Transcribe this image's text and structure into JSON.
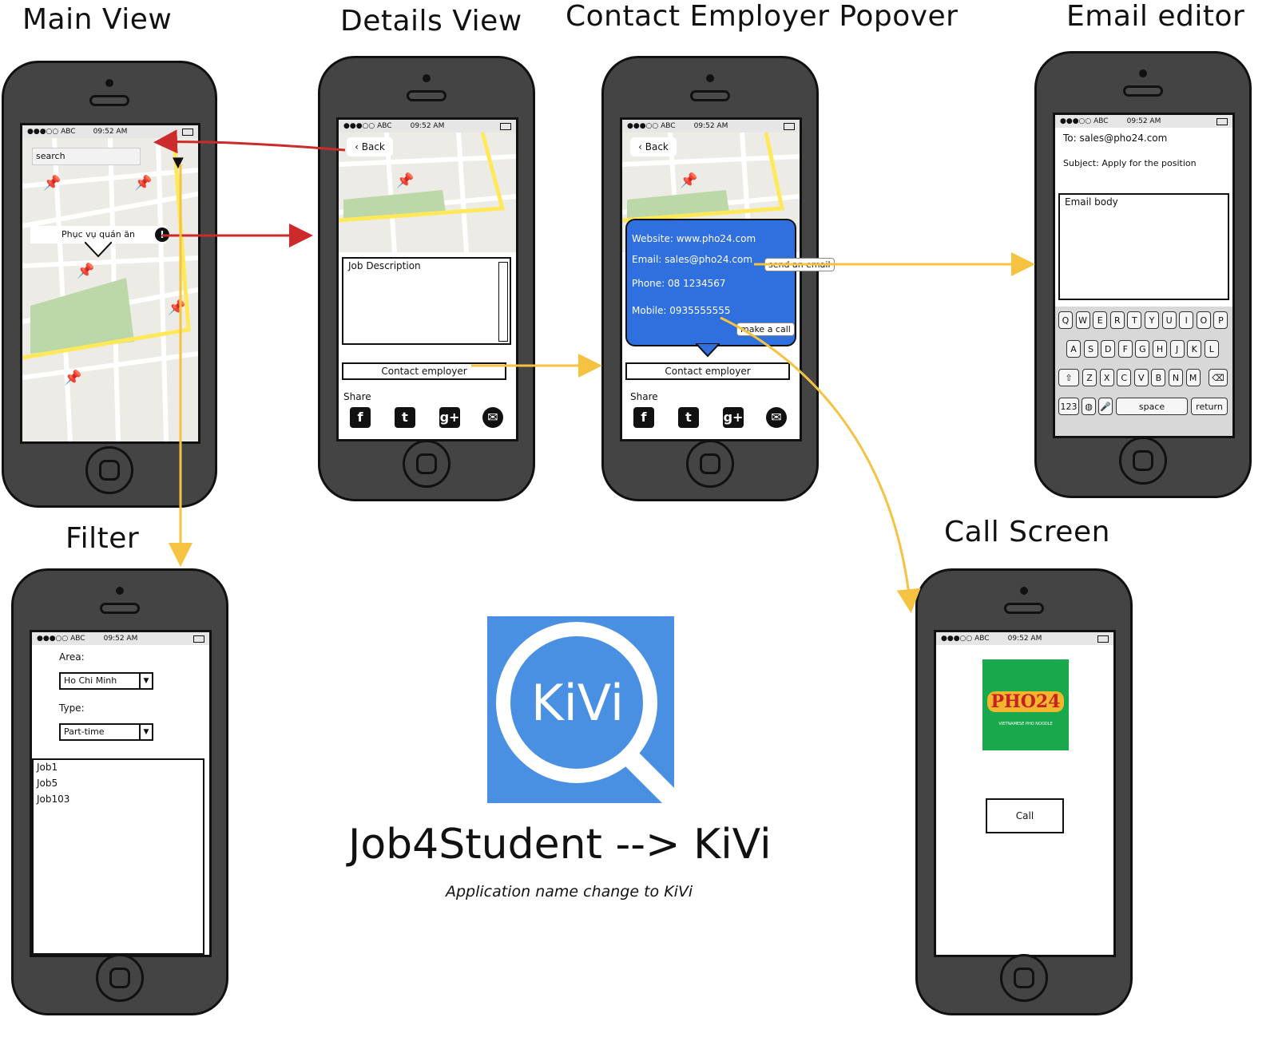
{
  "titles": {
    "main": "Main View",
    "details": "Details View",
    "popover": "Contact Employer Popover",
    "email": "Email editor",
    "filter": "Filter",
    "call": "Call Screen"
  },
  "status_bar": {
    "carrier": "●●●○○ ABC",
    "time": "09:52 AM"
  },
  "main_view": {
    "search_placeholder": "search",
    "map_tooltip": "Phục vụ quán ăn",
    "filter_icon": "funnel-icon",
    "info_icon": "exclamation-icon"
  },
  "details_view": {
    "back_label": "Back",
    "job_description": "Job Description",
    "contact_button": "Contact employer",
    "share_label": "Share",
    "social_icons": [
      "facebook-icon",
      "twitter-icon",
      "google-plus-icon",
      "wechat-icon"
    ]
  },
  "popover": {
    "back_label": "Back",
    "website": "Website: www.pho24.com",
    "email": "Email: sales@pho24.com",
    "phone": "Phone: 08 1234567",
    "mobile": "Mobile: 0935555555",
    "send_email_label": "send an email",
    "make_call_label": "make a call",
    "contact_button": "Contact employer",
    "share_label": "Share",
    "accent_color": "#2f6fde"
  },
  "email_editor": {
    "to": "To: sales@pho24.com",
    "subject": "Subject: Apply for the position",
    "body_placeholder": "Email body",
    "row1": [
      "Q",
      "W",
      "E",
      "R",
      "T",
      "Y",
      "U",
      "I",
      "O",
      "P"
    ],
    "row2": [
      "A",
      "S",
      "D",
      "F",
      "G",
      "H",
      "J",
      "K",
      "L"
    ],
    "row3": [
      "Z",
      "X",
      "C",
      "V",
      "B",
      "N",
      "M"
    ],
    "num_key": "123",
    "space_key": "space",
    "return_key": "return"
  },
  "filter": {
    "area_label": "Area:",
    "area_value": "Ho Chi Minh",
    "type_label": "Type:",
    "type_value": "Part-time",
    "jobs": [
      "Job1",
      "Job5",
      "Job103"
    ]
  },
  "call_screen": {
    "logo_text": "PHO24",
    "logo_tagline": "VIETNAMESE PHO NOODLE",
    "call_button": "Call"
  },
  "brand": {
    "logo_text": "KiVi",
    "headline": "Job4Student --> KiVi",
    "subtitle": "Application name change to KiVi",
    "logo_color": "#4a90e2"
  },
  "arrow_colors": {
    "red": "#cc2b2b",
    "yellow": "#f5c242"
  }
}
